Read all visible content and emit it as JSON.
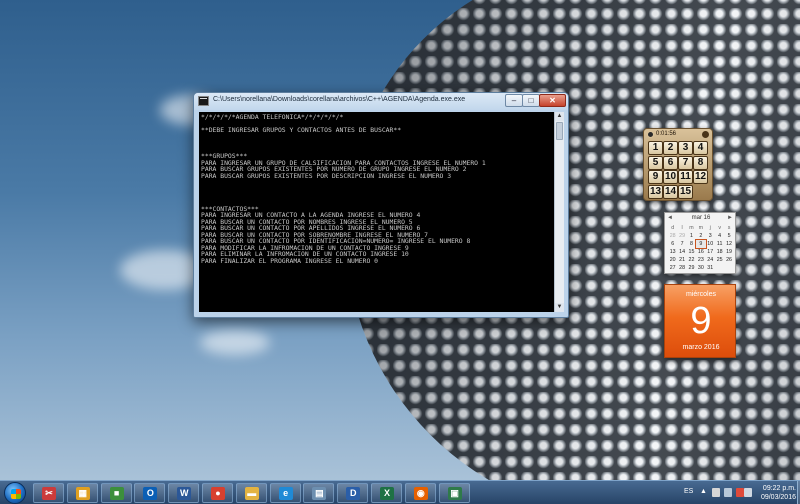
{
  "console": {
    "title": "C:\\Users\\norellana\\Downloads\\corellana\\archivos\\C++\\AGENDA\\Agenda.exe.exe",
    "minimize_label": "‒",
    "maximize_label": "□",
    "close_label": "✕",
    "lines": [
      "*/*/*/*/*AGENDA TELEFONICA*/*/*/*/*/*",
      "",
      "**DEBE INGRESAR GRUPOS Y CONTACTOS ANTES DE BUSCAR**",
      "",
      "",
      "",
      "***GRUPOS***",
      "PARA INGRESAR UN GRUPO DE CALSIFICACION PARA CONTACTOS INGRESE EL NUMERO 1",
      "PARA BUSCAR GRUPOS EXISTENTES POR NUMERO DE GRUPO INGRESE EL NUMERO 2",
      "PARA BUSCAR GRUPOS EXISTENTES POR DESCRIPCION INGRESE EL NUMERO 3",
      "",
      "",
      "",
      "",
      "***CONTACTOS***",
      "PARA INGRESAR UN CONTACTO A LA AGENDA INGRESE EL NUMERO 4",
      "PARA BUSCAR UN CONTACTO POR NOMBRES INGRESE EL NUMERO 5",
      "PARA BUSCAR UN CONTACTO POR APELLIDOS INGRESE EL NUMERO 6",
      "PARA BUSCAR UN CONTACTO POR SOBRENOMBRE INGRESE EL NUMERO 7",
      "PARA BUSCAR UN CONTACTO POR IDENTIFICACION=NUMERO= INGRESE EL NUMERO 8",
      "PARA MODIFICAR LA INFROMACION DE UN CONTACTO INGRESE 9",
      "PARA ELIMINAR LA INFROMACION DE UN CONTACTO INGRESE 10",
      "PARA FINALIZAR EL PROGRAMA INGRESE EL NUMERO 0"
    ]
  },
  "puzzle": {
    "time": "0:01:56",
    "tiles": [
      "1",
      "2",
      "3",
      "4",
      "5",
      "6",
      "7",
      "8",
      "9",
      "10",
      "11",
      "12",
      "13",
      "14",
      "15"
    ]
  },
  "calendar": {
    "month_label": "mar 16",
    "prev": "◄",
    "next": "►",
    "weekday_headers": [
      "d",
      "l",
      "m",
      "m",
      "j",
      "v",
      "s"
    ],
    "weeks": [
      [
        "28",
        "29",
        "1",
        "2",
        "3",
        "4",
        "5"
      ],
      [
        "6",
        "7",
        "8",
        "9",
        "10",
        "11",
        "12"
      ],
      [
        "13",
        "14",
        "15",
        "16",
        "17",
        "18",
        "19"
      ],
      [
        "20",
        "21",
        "22",
        "23",
        "24",
        "25",
        "26"
      ],
      [
        "27",
        "28",
        "29",
        "30",
        "31",
        "",
        ""
      ]
    ],
    "weekday_name": "miércoles",
    "day_number": "9",
    "month_year": "marzo 2016"
  },
  "taskbar": {
    "apps": [
      {
        "name": "snipping-tool-icon",
        "color": "#cc3b3b",
        "glyph": "✂"
      },
      {
        "name": "app-grid-icon",
        "color": "#e0a020",
        "glyph": "▦"
      },
      {
        "name": "green-app-icon",
        "color": "#3c8f3c",
        "glyph": "■"
      },
      {
        "name": "outlook-icon",
        "color": "#0b5fb5",
        "glyph": "O"
      },
      {
        "name": "word-icon",
        "color": "#2b5797",
        "glyph": "W"
      },
      {
        "name": "chrome-icon",
        "color": "#d8402f",
        "glyph": "●"
      },
      {
        "name": "folder-icon",
        "color": "#e3b341",
        "glyph": "▬"
      },
      {
        "name": "ie-icon",
        "color": "#1f8ad6",
        "glyph": "e"
      },
      {
        "name": "notes-icon",
        "color": "#6d8fb0",
        "glyph": "▤"
      },
      {
        "name": "devc-icon",
        "color": "#2a5ea8",
        "glyph": "D"
      },
      {
        "name": "excel-icon",
        "color": "#1e7145",
        "glyph": "X"
      },
      {
        "name": "firefox-icon",
        "color": "#e66000",
        "glyph": "◉"
      },
      {
        "name": "console-app-icon",
        "color": "#2f7a4a",
        "glyph": "▣"
      }
    ],
    "language": "ES",
    "time": "09:22 p.m.",
    "date": "09/03/2016"
  }
}
